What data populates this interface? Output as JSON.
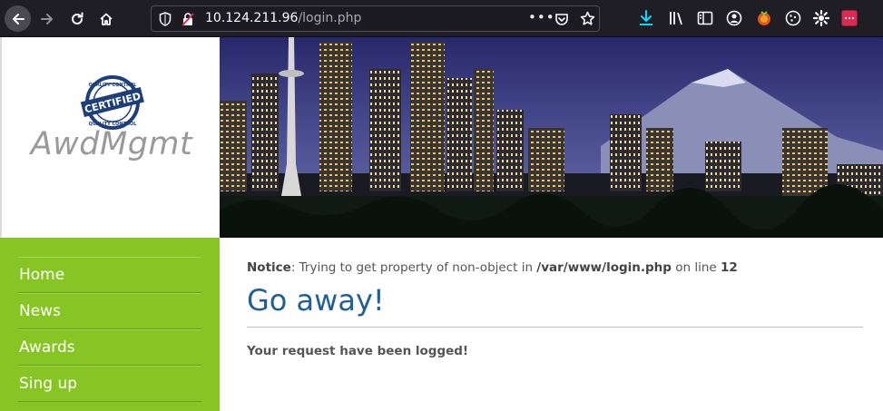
{
  "browser": {
    "url_host": "10.124.211.96",
    "url_path": "/login.php",
    "more_label": "•••",
    "icons": [
      "back-icon",
      "forward-icon",
      "reload-icon",
      "home-icon",
      "shield-icon",
      "insecure-lock-icon",
      "page-actions-icon",
      "pocket-icon",
      "bookmark-star-icon",
      "download-icon",
      "library-icon",
      "reader-sidebar-icon",
      "account-icon",
      "extension-icon",
      "cookie-icon",
      "settings-icon",
      "addon-icon"
    ]
  },
  "site": {
    "name": "AwdMgmt",
    "badge_text": "CERTIFIED",
    "badge_ring_text": "QUALITY CONTROL"
  },
  "nav": {
    "items": [
      {
        "label": "Home"
      },
      {
        "label": "News"
      },
      {
        "label": "Awards"
      },
      {
        "label": "Sing up"
      }
    ]
  },
  "content": {
    "notice_label": "Notice",
    "notice_message": ": Trying to get property of non-object in ",
    "notice_file": "/var/www/login.php",
    "notice_on_line": " on line ",
    "notice_line": "12",
    "heading": "Go away!",
    "logged_message": "Your request have been logged!"
  },
  "colors": {
    "toolbar_bg": "#1f1e25",
    "nav_green": "#86c524",
    "heading_blue": "#1e5f9a"
  }
}
